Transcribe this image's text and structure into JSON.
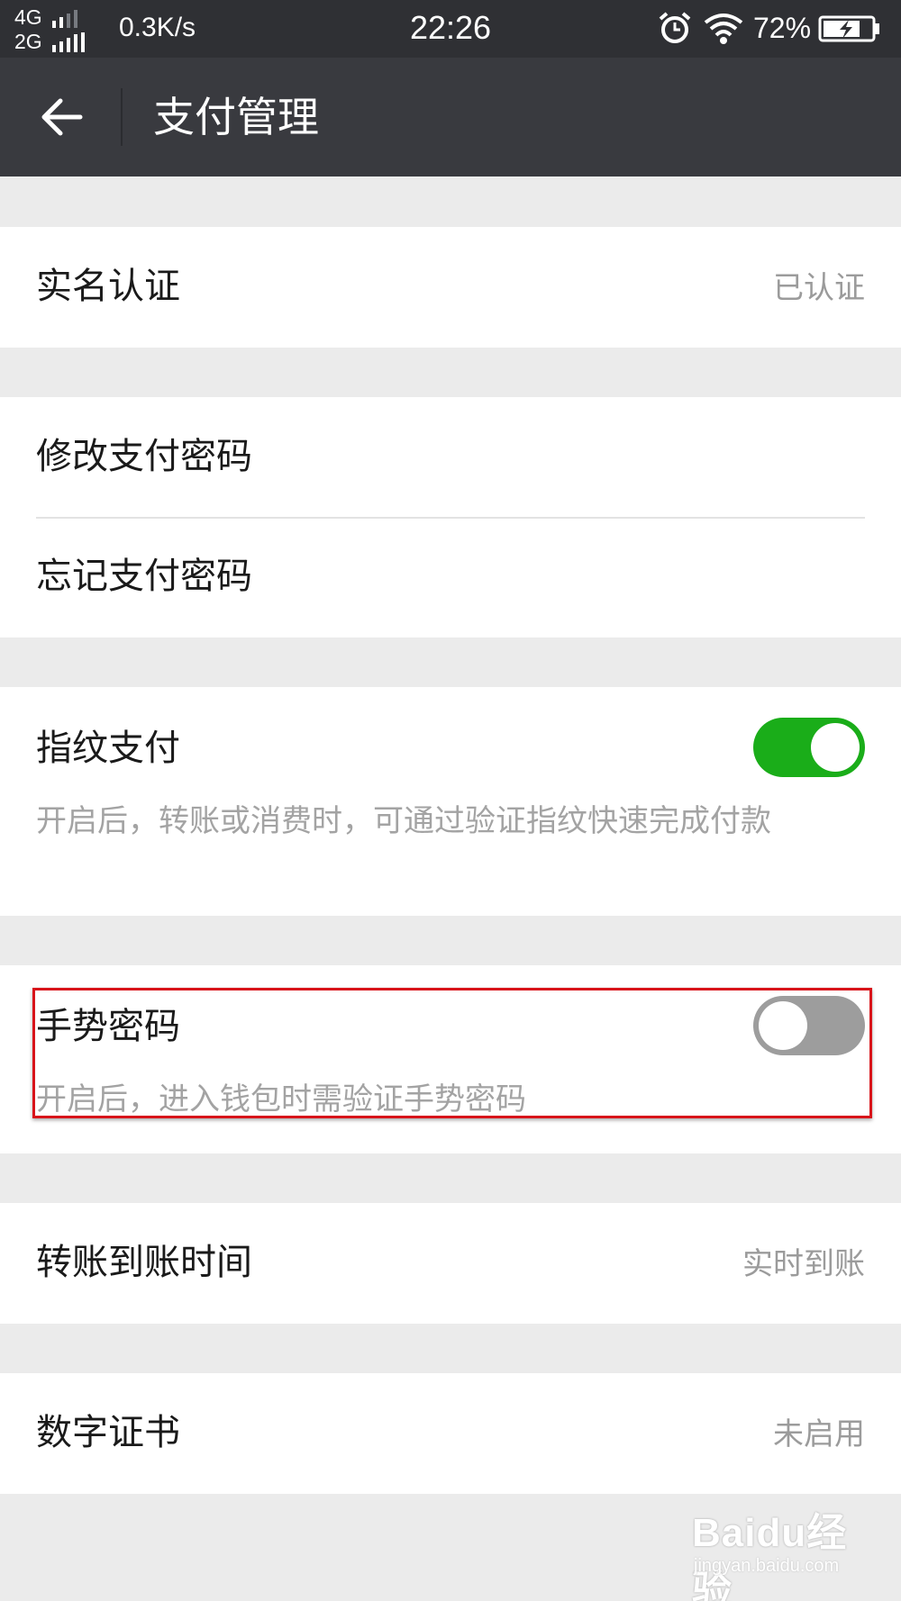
{
  "status_bar": {
    "network_1": "4G",
    "network_2": "2G",
    "net_speed": "0.3K/s",
    "time": "22:26",
    "battery_percent": "72%",
    "icons": [
      "signal-icon",
      "alarm-icon",
      "wifi-icon",
      "battery-charging-icon"
    ]
  },
  "header": {
    "title": "支付管理",
    "back_icon": "arrow-left-icon"
  },
  "settings": {
    "real_name": {
      "label": "实名认证",
      "value": "已认证"
    },
    "change_password": {
      "label": "修改支付密码"
    },
    "forgot_password": {
      "label": "忘记支付密码"
    },
    "fingerprint": {
      "label": "指纹支付",
      "description": "开启后，转账或消费时，可通过验证指纹快速完成付款",
      "enabled": true
    },
    "gesture": {
      "label": "手势密码",
      "description": "开启后，进入钱包时需验证手势密码",
      "enabled": false
    },
    "transfer_time": {
      "label": "转账到账时间",
      "value": "实时到账"
    },
    "certificate": {
      "label": "数字证书",
      "value": "未启用"
    }
  },
  "watermark": {
    "logo": "Baidu经验",
    "url": "jingyan.baidu.com"
  },
  "colors": {
    "status_bar": "#2f3034",
    "title_bar": "#393a3f",
    "background": "#ebebeb",
    "toggle_on": "#1aad19",
    "toggle_off": "#9d9d9d",
    "highlight": "#d8141a"
  }
}
